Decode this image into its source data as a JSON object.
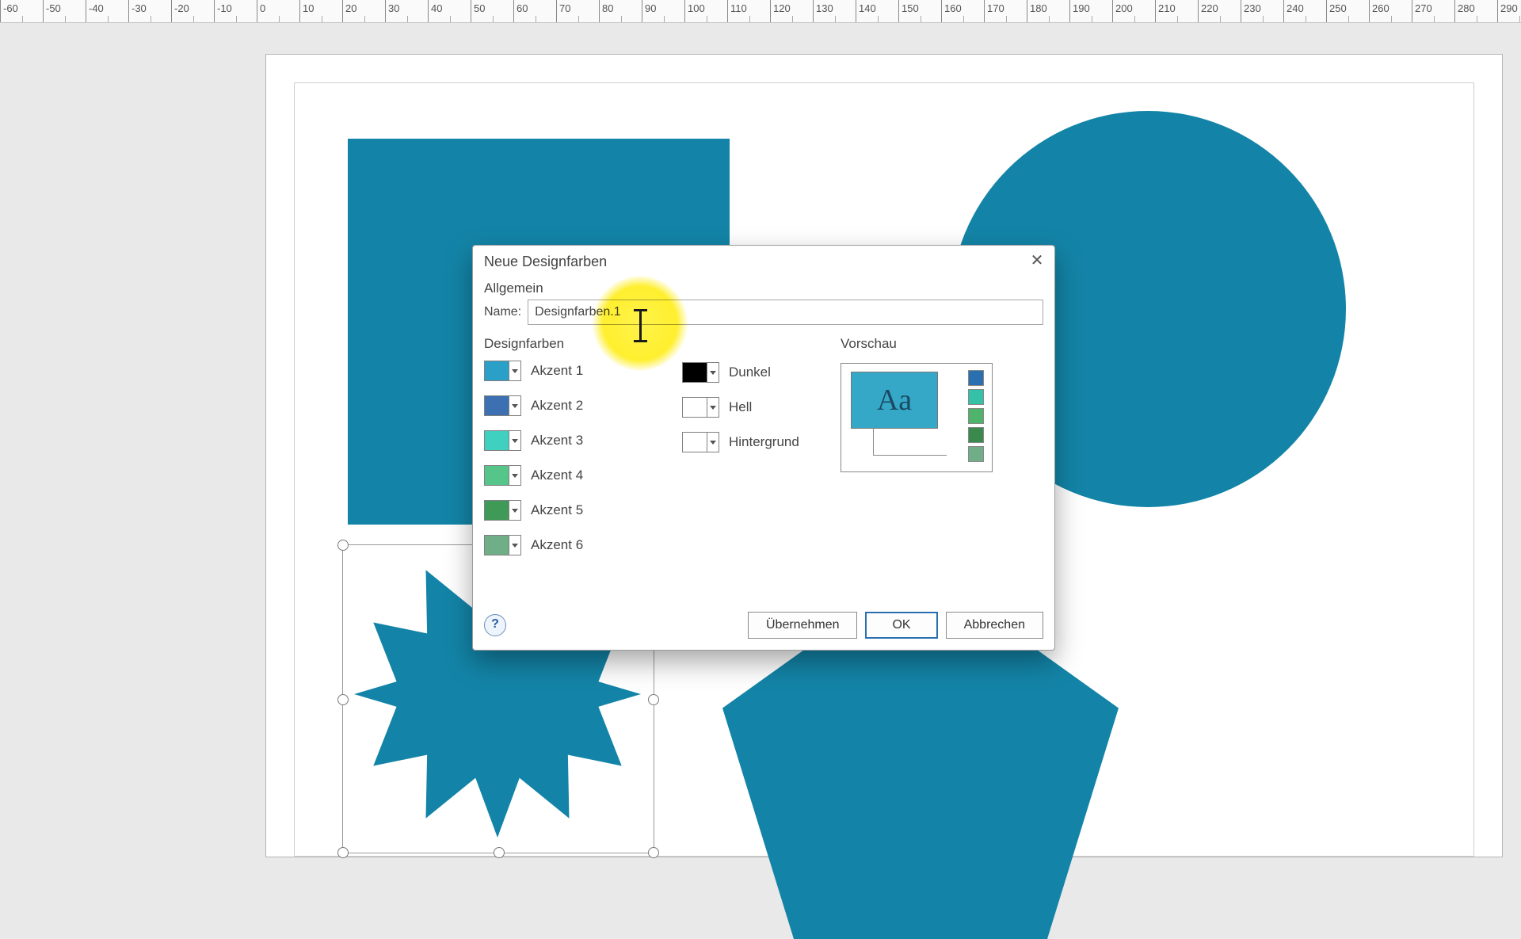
{
  "ruler": {
    "start": -60,
    "end": 290,
    "step": 10
  },
  "dialog": {
    "title": "Neue Designfarben",
    "section_general": "Allgemein",
    "name_label": "Name:",
    "name_value": "Designfarben.1",
    "section_colors": "Designfarben",
    "section_preview": "Vorschau",
    "accents": [
      {
        "label": "Akzent 1",
        "color": "#2a9fc7"
      },
      {
        "label": "Akzent 2",
        "color": "#3d6fb3"
      },
      {
        "label": "Akzent 3",
        "color": "#3fd0c0"
      },
      {
        "label": "Akzent 4",
        "color": "#55c58a"
      },
      {
        "label": "Akzent 5",
        "color": "#3f9a57"
      },
      {
        "label": "Akzent 6",
        "color": "#6fae86"
      }
    ],
    "extras": [
      {
        "label": "Dunkel",
        "color": "#000000"
      },
      {
        "label": "Hell",
        "color": "#ffffff"
      },
      {
        "label": "Hintergrund",
        "color": "#ffffff"
      }
    ],
    "preview_sample": "Aa",
    "preview_minis": [
      "#2a6fb0",
      "#35c0a8",
      "#4fb36b",
      "#3b8a4d",
      "#6fae86"
    ],
    "btn_apply": "Übernehmen",
    "btn_ok": "OK",
    "btn_cancel": "Abbrechen",
    "help": "?"
  },
  "shapes_color": "#1384a7"
}
